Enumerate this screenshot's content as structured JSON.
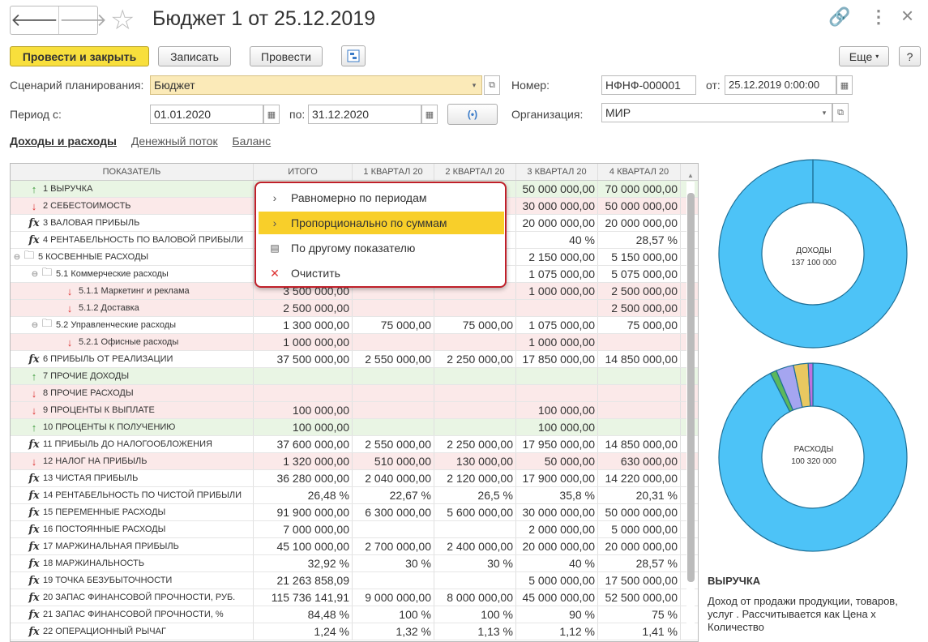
{
  "header": {
    "title": "Бюджет 1 от 25.12.2019",
    "back": "🡐",
    "forward": "🡒",
    "star": "☆",
    "link_icon": "🔗",
    "menu_icon": "⋮",
    "close_icon": "×"
  },
  "toolbar": {
    "post_close": "Провести и закрыть",
    "save": "Записать",
    "post": "Провести",
    "more": "Еще",
    "help": "?"
  },
  "form": {
    "scenario_label": "Сценарий планирования:",
    "scenario_value": "Бюджет",
    "number_label": "Номер:",
    "number_value": "НФНФ-000001",
    "date_label": "от:",
    "date_value": "25.12.2019  0:00:00",
    "period_from_label": "Период с:",
    "period_from_value": "01.01.2020",
    "period_to_label": "по:",
    "period_to_value": "31.12.2020",
    "org_label": "Организация:",
    "org_value": "МИР"
  },
  "tabs": [
    "Доходы и расходы",
    "Денежный поток",
    "Баланс"
  ],
  "table": {
    "columns": [
      "ПОКАЗАТЕЛЬ",
      "ИТОГО",
      "1 КВАРТАЛ 20",
      "2 КВАРТАЛ 20",
      "3 КВАРТАЛ 20",
      "4 КВАРТАЛ 20"
    ],
    "rows": [
      {
        "type": "up",
        "bg": "g",
        "level": 0,
        "name": "1  ВЫРУЧКА",
        "vals": [
          "",
          "",
          "",
          "50 000 000,00",
          "70 000 000,00"
        ]
      },
      {
        "type": "dn",
        "bg": "r",
        "level": 0,
        "name": "2  СЕБЕСТОИМОСТЬ",
        "vals": [
          "",
          "",
          "",
          "30 000 000,00",
          "50 000 000,00"
        ]
      },
      {
        "type": "fx",
        "bg": "",
        "level": 0,
        "name": "3  ВАЛОВАЯ ПРИБЫЛЬ",
        "vals": [
          "",
          "",
          "",
          "20 000 000,00",
          "20 000 000,00"
        ]
      },
      {
        "type": "fx",
        "bg": "",
        "level": 0,
        "name": "4  РЕНТАБЕЛЬНОСТЬ ПО ВАЛОВОЙ ПРИБЫЛИ",
        "vals": [
          "",
          "",
          "",
          "40 %",
          "28,57 %"
        ]
      },
      {
        "type": "fold",
        "bg": "",
        "level": 0,
        "tog": "⊖",
        "name": "5  КОСВЕННЫЕ РАСХОДЫ",
        "vals": [
          "",
          "",
          "",
          "2 150 000,00",
          "5 150 000,00"
        ]
      },
      {
        "type": "fold",
        "bg": "",
        "level": 1,
        "tog": "⊖",
        "name": "5.1   Коммерческие расходы",
        "vals": [
          "",
          "",
          "",
          "1 075 000,00",
          "5 075 000,00"
        ]
      },
      {
        "type": "dn",
        "bg": "r",
        "level": 2,
        "name": "5.1.1   Маркетинг и реклама",
        "vals": [
          "3 500 000,00",
          "",
          "",
          "1 000 000,00",
          "2 500 000,00"
        ]
      },
      {
        "type": "dn",
        "bg": "r",
        "level": 2,
        "name": "5.1.2   Доставка",
        "vals": [
          "2 500 000,00",
          "",
          "",
          "",
          "2 500 000,00"
        ]
      },
      {
        "type": "fold",
        "bg": "",
        "level": 1,
        "tog": "⊖",
        "name": "5.2   Управленческие расходы",
        "vals": [
          "1 300 000,00",
          "75 000,00",
          "75 000,00",
          "1 075 000,00",
          "75 000,00"
        ]
      },
      {
        "type": "dn",
        "bg": "r",
        "level": 2,
        "name": "5.2.1   Офисные расходы",
        "vals": [
          "1 000 000,00",
          "",
          "",
          "1 000 000,00",
          ""
        ]
      },
      {
        "type": "fx",
        "bg": "",
        "level": 0,
        "name": "6  ПРИБЫЛЬ ОТ РЕАЛИЗАЦИИ",
        "vals": [
          "37 500 000,00",
          "2 550 000,00",
          "2 250 000,00",
          "17 850 000,00",
          "14 850 000,00"
        ]
      },
      {
        "type": "up",
        "bg": "g",
        "level": 0,
        "name": "7  ПРОЧИЕ ДОХОДЫ",
        "vals": [
          "",
          "",
          "",
          "",
          ""
        ]
      },
      {
        "type": "dn",
        "bg": "r",
        "level": 0,
        "name": "8  ПРОЧИЕ РАСХОДЫ",
        "vals": [
          "",
          "",
          "",
          "",
          ""
        ]
      },
      {
        "type": "dn",
        "bg": "r",
        "level": 0,
        "name": "9  ПРОЦЕНТЫ К ВЫПЛАТЕ",
        "vals": [
          "100 000,00",
          "",
          "",
          "100 000,00",
          ""
        ]
      },
      {
        "type": "up",
        "bg": "g",
        "level": 0,
        "name": "10  ПРОЦЕНТЫ К ПОЛУЧЕНИЮ",
        "vals": [
          "100 000,00",
          "",
          "",
          "100 000,00",
          ""
        ]
      },
      {
        "type": "fx",
        "bg": "",
        "level": 0,
        "name": "11  ПРИБЫЛЬ ДО НАЛОГООБЛОЖЕНИЯ",
        "vals": [
          "37 600 000,00",
          "2 550 000,00",
          "2 250 000,00",
          "17 950 000,00",
          "14 850 000,00"
        ]
      },
      {
        "type": "dn",
        "bg": "r",
        "level": 0,
        "name": "12  НАЛОГ НА ПРИБЫЛЬ",
        "vals": [
          "1 320 000,00",
          "510 000,00",
          "130 000,00",
          "50 000,00",
          "630 000,00"
        ]
      },
      {
        "type": "fx",
        "bg": "",
        "level": 0,
        "name": "13  ЧИСТАЯ ПРИБЫЛЬ",
        "vals": [
          "36 280 000,00",
          "2 040 000,00",
          "2 120 000,00",
          "17 900 000,00",
          "14 220 000,00"
        ]
      },
      {
        "type": "fx",
        "bg": "",
        "level": 0,
        "name": "14  РЕНТАБЕЛЬНОСТЬ ПО ЧИСТОЙ ПРИБЫЛИ",
        "vals": [
          "26,48 %",
          "22,67 %",
          "26,5 %",
          "35,8 %",
          "20,31 %"
        ]
      },
      {
        "type": "fx",
        "bg": "",
        "level": 0,
        "name": "15  ПЕРЕМЕННЫЕ РАСХОДЫ",
        "vals": [
          "91 900 000,00",
          "6 300 000,00",
          "5 600 000,00",
          "30 000 000,00",
          "50 000 000,00"
        ]
      },
      {
        "type": "fx",
        "bg": "",
        "level": 0,
        "name": "16  ПОСТОЯННЫЕ РАСХОДЫ",
        "vals": [
          "7 000 000,00",
          "",
          "",
          "2 000 000,00",
          "5 000 000,00"
        ]
      },
      {
        "type": "fx",
        "bg": "",
        "level": 0,
        "name": "17  МАРЖИНАЛЬНАЯ ПРИБЫЛЬ",
        "vals": [
          "45 100 000,00",
          "2 700 000,00",
          "2 400 000,00",
          "20 000 000,00",
          "20 000 000,00"
        ]
      },
      {
        "type": "fx",
        "bg": "",
        "level": 0,
        "name": "18  МАРЖИНАЛЬНОСТЬ",
        "vals": [
          "32,92 %",
          "30 %",
          "30 %",
          "40 %",
          "28,57 %"
        ]
      },
      {
        "type": "fx",
        "bg": "",
        "level": 0,
        "name": "19  ТОЧКА БЕЗУБЫТОЧНОСТИ",
        "vals": [
          "21 263 858,09",
          "",
          "",
          "5 000 000,00",
          "17 500 000,00"
        ]
      },
      {
        "type": "fx",
        "bg": "",
        "level": 0,
        "name": "20  ЗАПАС ФИНАНСОВОЙ ПРОЧНОСТИ, РУБ.",
        "vals": [
          "115 736 141,91",
          "9 000 000,00",
          "8 000 000,00",
          "45 000 000,00",
          "52 500 000,00"
        ]
      },
      {
        "type": "fx",
        "bg": "",
        "level": 0,
        "name": "21  ЗАПАС ФИНАНСОВОЙ ПРОЧНОСТИ, %",
        "vals": [
          "84,48 %",
          "100 %",
          "100 %",
          "90 %",
          "75 %"
        ]
      },
      {
        "type": "fx",
        "bg": "",
        "level": 0,
        "name": "22  ОПЕРАЦИОННЫЙ РЫЧАГ",
        "vals": [
          "1,24 %",
          "1,32 %",
          "1,13 %",
          "1,12 %",
          "1,41 %"
        ]
      }
    ]
  },
  "popup": {
    "items": [
      {
        "label": "Равномерно по периодам",
        "icon": "›"
      },
      {
        "label": "Пропорционально по суммам",
        "icon": "›"
      },
      {
        "label": "По другому показателю",
        "icon": "▤"
      },
      {
        "label": "Очистить",
        "icon": "✕"
      }
    ]
  },
  "donut_income": {
    "label": "ДОХОДЫ",
    "value": "137 100 000"
  },
  "donut_expense": {
    "label": "РАСХОДЫ",
    "value": "100 320 000"
  },
  "description": {
    "title": "ВЫРУЧКА",
    "text": "Доход от продажи продукции,  товаров, услуг . Рассчитывается как Цена х Количество"
  },
  "chart_data": [
    {
      "type": "pie",
      "title": "",
      "series": [
        {
          "values": [
            100
          ]
        }
      ],
      "colors": [
        "#4dc3f7"
      ]
    },
    {
      "type": "pie",
      "title": "",
      "series": [
        {
          "values": [
            91.6,
            1.1,
            3.0,
            2.5,
            0.8
          ]
        }
      ],
      "colors": [
        "#4dc3f7",
        "#5cb85c",
        "#a5a5f0",
        "#e8c860",
        "#c070e0"
      ]
    }
  ]
}
